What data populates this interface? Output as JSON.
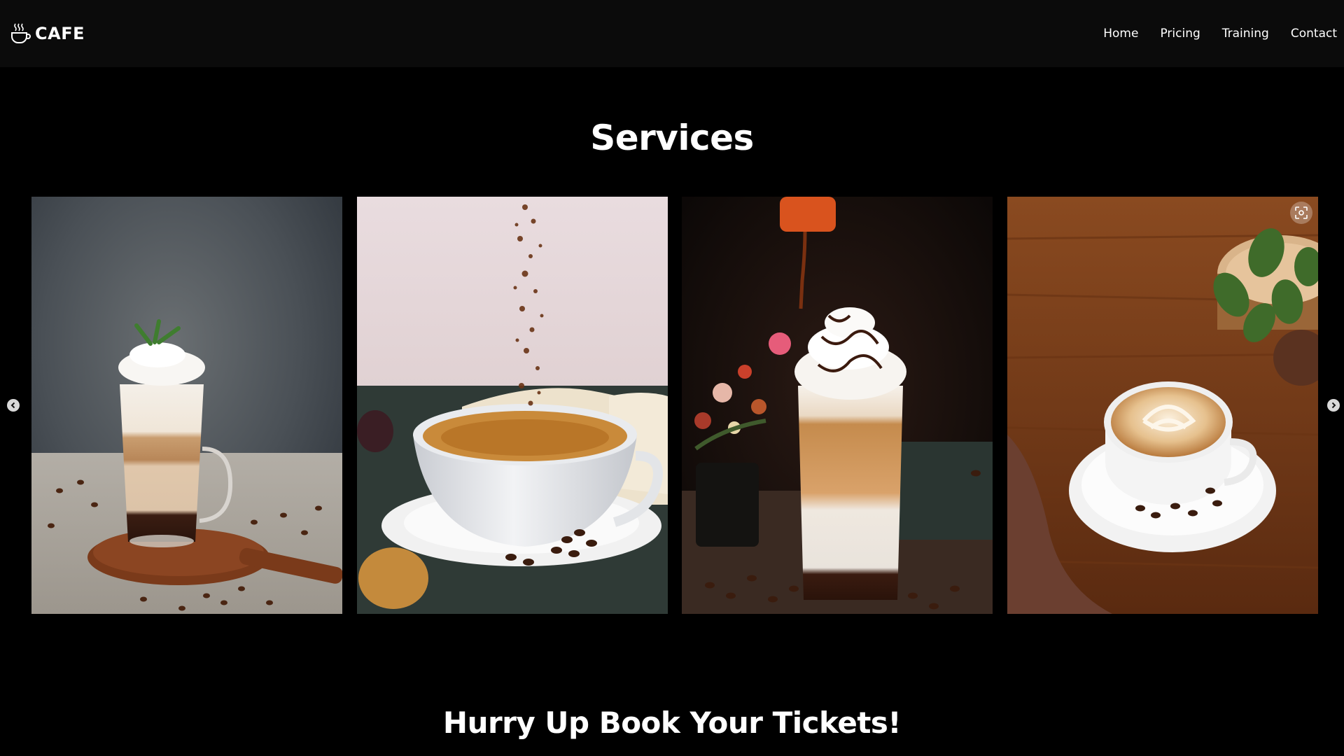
{
  "brand": {
    "name": "CAFE",
    "icon": "coffee-cup-icon"
  },
  "nav": {
    "items": [
      {
        "label": "Home"
      },
      {
        "label": "Pricing"
      },
      {
        "label": "Training"
      },
      {
        "label": "Contact"
      }
    ]
  },
  "services": {
    "title": "Services",
    "cards": [
      {
        "image": "iced-latte-photo"
      },
      {
        "image": "cappuccino-pour-photo"
      },
      {
        "image": "iced-caramel-latte-photo"
      },
      {
        "image": "latte-art-photo"
      }
    ],
    "controls": {
      "prev_icon": "chevron-left-icon",
      "next_icon": "chevron-right-icon",
      "lens_icon": "visual-search-icon"
    }
  },
  "booking": {
    "title": "Hurry Up Book Your Tickets!"
  },
  "colors": {
    "background": "#000000",
    "header_background": "#0b0b0b",
    "text": "#ffffff"
  }
}
